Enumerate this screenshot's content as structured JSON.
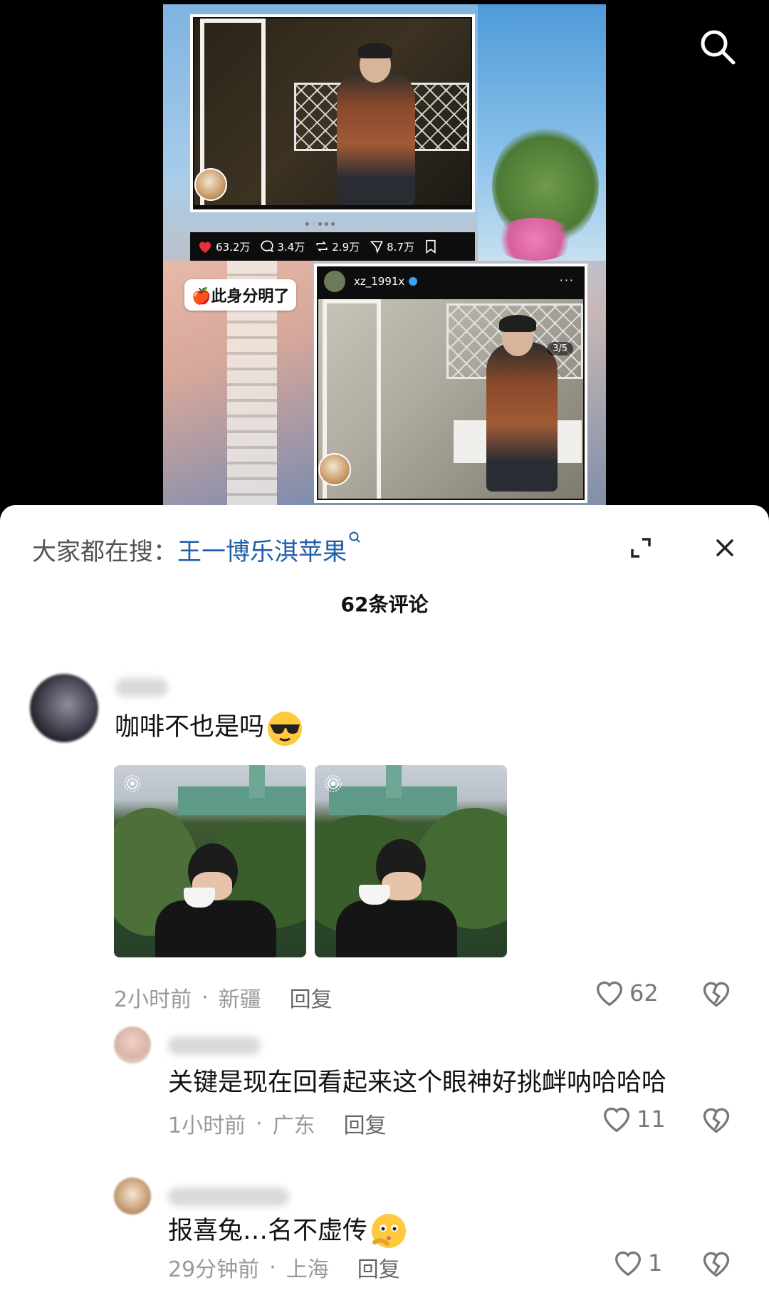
{
  "video": {
    "post_top": {
      "stats": {
        "likes": "63.2万",
        "comments": "3.4万",
        "reposts": "2.9万",
        "shares": "8.7万"
      }
    },
    "sticker_text": "🍎此身分明了",
    "post_bottom": {
      "username": "xz_1991x",
      "more": "···",
      "counter": "3/5"
    }
  },
  "panel": {
    "suggest_prefix": "大家都在搜：",
    "suggest_term": "王一博乐淇苹果",
    "comment_count": "62条评论"
  },
  "comments": [
    {
      "text": "咖啡不也是吗",
      "time": "2小时前",
      "location": "新疆",
      "reply": "回复",
      "likes": "62"
    },
    {
      "text": "关键是现在回看起来这个眼神好挑衅呐哈哈哈",
      "time": "1小时前",
      "location": "广东",
      "reply": "回复",
      "likes": "11"
    },
    {
      "text": "报喜兔…名不虚传",
      "time": "29分钟前",
      "location": "上海",
      "reply": "回复",
      "likes": "1"
    }
  ],
  "meta_separator": "·",
  "icons": {
    "search": "search-icon",
    "expand": "expand-icon",
    "close": "close-icon",
    "like": "heart-outline-icon",
    "dislike": "broken-heart-icon"
  },
  "colors": {
    "link_blue": "#1f5ea8",
    "like_red": "#e8303d",
    "verified_blue": "#3aa0ff"
  }
}
